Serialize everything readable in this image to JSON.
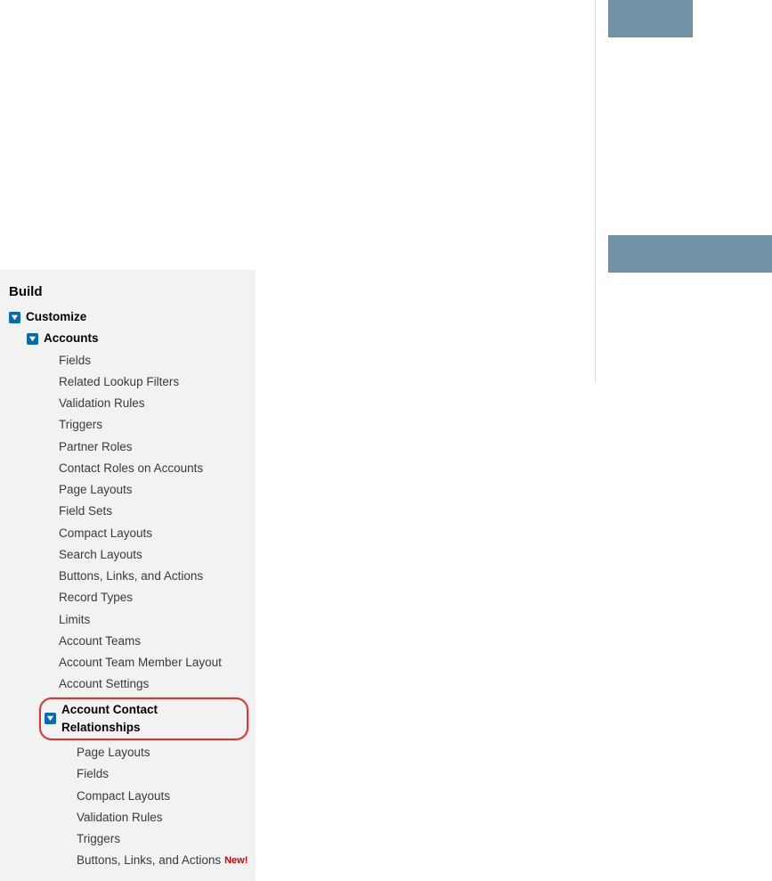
{
  "sidebar": {
    "section": "Build",
    "customize": "Customize",
    "accounts": "Accounts",
    "accounts_children": [
      "Fields",
      "Related Lookup Filters",
      "Validation Rules",
      "Triggers",
      "Partner Roles",
      "Contact Roles on Accounts",
      "Page Layouts",
      "Field Sets",
      "Compact Layouts",
      "Search Layouts",
      "Buttons, Links, and Actions",
      "Record Types",
      "Limits",
      "Account Teams",
      "Account Team Member Layout",
      "Account Settings"
    ],
    "acr": "Account Contact Relationships",
    "acr_children": [
      "Page Layouts",
      "Fields",
      "Compact Layouts",
      "Validation Rules",
      "Triggers",
      "Buttons, Links, and Actions"
    ],
    "new_badge": "New!"
  }
}
